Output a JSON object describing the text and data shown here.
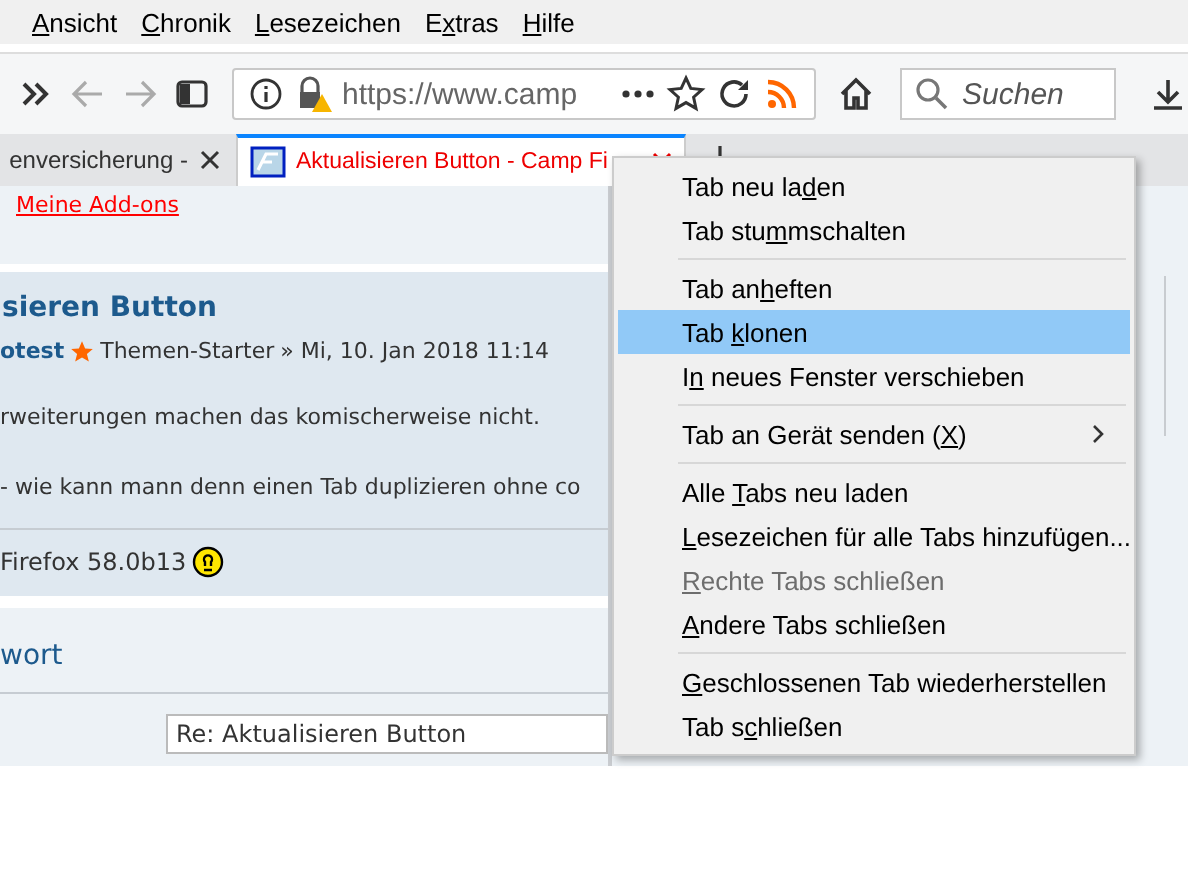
{
  "menubar": [
    {
      "accesskey": "A",
      "after": "nsicht"
    },
    {
      "accesskey": "C",
      "after": "hronik"
    },
    {
      "accesskey": "L",
      "after": "esezeichen"
    },
    {
      "before": "E",
      "accesskey": "x",
      "after": "tras"
    },
    {
      "accesskey": "H",
      "after": "ilfe"
    }
  ],
  "toolbar": {
    "url": "https://www.camp",
    "search": {
      "placeholder": "Suchen"
    }
  },
  "tabs": [
    {
      "title": "enversicherung -",
      "selected": false
    },
    {
      "title": "Aktualisieren Button - Camp Fi",
      "selected": true
    }
  ],
  "page": {
    "link": "Meine Add-ons",
    "post": {
      "title": "sieren Button",
      "author": "otest",
      "role": "Themen-Starter",
      "date": "» Mi, 10. Jan 2018 11:14",
      "lines": [
        "rweiterungen machen das komischerweise nicht.",
        "- wie kann mann denn einen Tab duplizieren ohne co"
      ],
      "signature": "Firefox 58.0b13"
    },
    "reply": {
      "heading": "wort",
      "subject": "Re: Aktualisieren Button"
    }
  },
  "context_menu": [
    [
      {
        "before": "Tab neu la",
        "accesskey": "d",
        "after": "en",
        "kind": "item",
        "selected": false,
        "disabled": false
      },
      {
        "before": "Tab stu",
        "accesskey": "m",
        "after": "mschalten",
        "kind": "item",
        "selected": false,
        "disabled": false
      }
    ],
    [
      {
        "before": "Tab an",
        "accesskey": "h",
        "after": "eften",
        "kind": "item",
        "selected": false,
        "disabled": false
      },
      {
        "before": "Tab ",
        "accesskey": "k",
        "after": "lonen",
        "kind": "item",
        "selected": true,
        "disabled": false
      },
      {
        "before": "I",
        "accesskey": "n",
        "after": " neues Fenster verschieben",
        "kind": "item",
        "selected": false,
        "disabled": false
      }
    ],
    [
      {
        "before": "Tab an Gerät senden (",
        "accesskey": "X",
        "after": ")",
        "kind": "submenu",
        "selected": false,
        "disabled": false
      }
    ],
    [
      {
        "before": "Alle ",
        "accesskey": "T",
        "after": "abs neu laden",
        "kind": "item",
        "selected": false,
        "disabled": false
      },
      {
        "accesskey": "L",
        "after": "esezeichen für alle Tabs hinzufügen...",
        "kind": "item",
        "selected": false,
        "disabled": false
      },
      {
        "accesskey": "R",
        "after": "echte Tabs schließen",
        "kind": "item",
        "selected": false,
        "disabled": true
      },
      {
        "accesskey": "A",
        "after": "ndere Tabs schließen",
        "kind": "item",
        "selected": false,
        "disabled": false
      }
    ],
    [
      {
        "accesskey": "G",
        "after": "eschlossenen Tab wiederherstellen",
        "kind": "item",
        "selected": false,
        "disabled": false
      },
      {
        "before": "Tab s",
        "accesskey": "c",
        "after": "hließen",
        "kind": "item",
        "selected": false,
        "disabled": false
      }
    ]
  ]
}
